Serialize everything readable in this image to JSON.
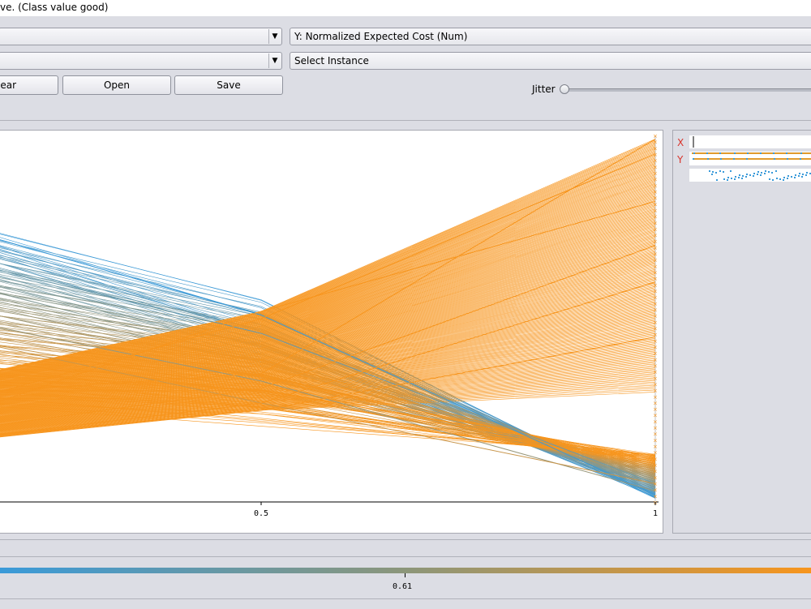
{
  "window": {
    "title": "ve. (Class value good)"
  },
  "controls": {
    "x_axis_select": "",
    "y_axis_select": "Y: Normalized Expected Cost (Num)",
    "colour_select": "",
    "instance_select": "Select Instance",
    "clear_label": "lear",
    "open_label": "Open",
    "save_label": "Save",
    "jitter_label": "Jitter"
  },
  "plot": {
    "x_tick_labels": [
      "0.5",
      "1"
    ],
    "side_labels": {
      "x": "X",
      "y": "Y"
    },
    "class_colour_tick": "0.61",
    "colors": {
      "low": "#3a9ad9",
      "high": "#f7951d"
    }
  },
  "chart_data": {
    "type": "line",
    "x": [
      0,
      0.5,
      1
    ],
    "xlim": [
      0,
      1
    ],
    "description_colours": [
      "#3a9ad9",
      "#f7951d"
    ],
    "series": [
      {
        "values": [
          0.82,
          0.51,
          0.02
        ]
      },
      {
        "values": [
          0.72,
          0.46,
          0.05
        ]
      },
      {
        "values": [
          0.55,
          0.33,
          0.03
        ]
      },
      {
        "values": [
          0.5,
          0.27,
          0.05
        ]
      },
      {
        "values": [
          0.28,
          0.35,
          0.99
        ]
      },
      {
        "values": [
          0.2,
          0.5,
          0.95
        ]
      },
      {
        "values": [
          0.15,
          0.52,
          0.82
        ]
      },
      {
        "values": [
          0.16,
          0.31,
          0.7
        ]
      },
      {
        "values": [
          0.14,
          0.27,
          0.6
        ]
      },
      {
        "values": [
          0.15,
          0.25,
          0.45
        ]
      }
    ],
    "class_colour_range": [
      0.61
    ]
  }
}
